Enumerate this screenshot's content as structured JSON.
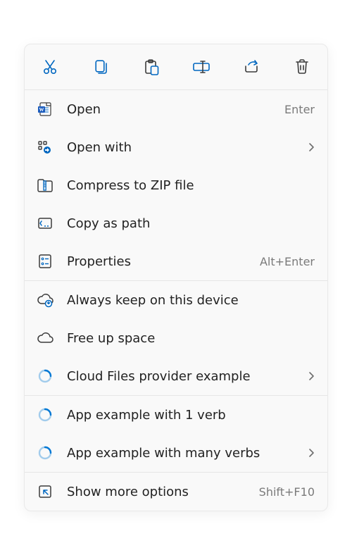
{
  "toolbar": {
    "cut": "Cut",
    "copy": "Copy",
    "paste": "Paste",
    "rename": "Rename",
    "share": "Share",
    "delete": "Delete"
  },
  "colors": {
    "accent": "#0067c0",
    "stroke": "#3b3b3b",
    "muted": "#777777"
  },
  "groups": [
    {
      "items": [
        {
          "id": "open",
          "icon": "word-icon",
          "label": "Open",
          "accel": "Enter"
        },
        {
          "id": "open-with",
          "icon": "open-with-icon",
          "label": "Open with",
          "submenu": true
        },
        {
          "id": "compress",
          "icon": "zip-icon",
          "label": "Compress to ZIP file"
        },
        {
          "id": "copy-path",
          "icon": "copy-path-icon",
          "label": "Copy as path"
        },
        {
          "id": "properties",
          "icon": "properties-icon",
          "label": "Properties",
          "accel": "Alt+Enter"
        }
      ]
    },
    {
      "items": [
        {
          "id": "always-keep",
          "icon": "cloud-keep-icon",
          "label": "Always keep on this device"
        },
        {
          "id": "free-up",
          "icon": "cloud-icon",
          "label": "Free up space"
        },
        {
          "id": "cloud-provider",
          "icon": "spinner-icon",
          "label": "Cloud Files provider example",
          "submenu": true
        }
      ]
    },
    {
      "items": [
        {
          "id": "app-one-verb",
          "icon": "spinner-icon",
          "label": "App example with 1 verb"
        },
        {
          "id": "app-many-verbs",
          "icon": "spinner-icon",
          "label": "App example with many verbs",
          "submenu": true
        }
      ]
    },
    {
      "items": [
        {
          "id": "show-more",
          "icon": "show-more-icon",
          "label": "Show more options",
          "accel": "Shift+F10"
        }
      ]
    }
  ]
}
